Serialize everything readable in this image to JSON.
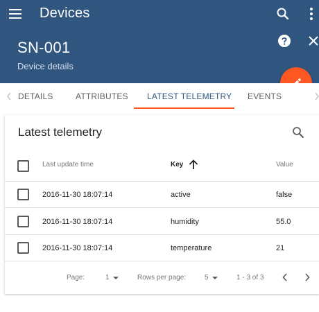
{
  "appbar": {
    "title": "Devices",
    "menu_icon": "menu-icon",
    "search_icon": "search-icon",
    "more_icon": "more-vert-icon"
  },
  "device": {
    "name": "SN-001",
    "subtitle": "Device details",
    "help_icon": "help-icon",
    "close_icon": "close-icon"
  },
  "fab": {
    "icon": "edit-icon",
    "color": "#ff5722"
  },
  "tabs": [
    {
      "label": "DETAILS"
    },
    {
      "label": "ATTRIBUTES"
    },
    {
      "label": "LATEST TELEMETRY",
      "active": true
    },
    {
      "label": "EVENTS"
    }
  ],
  "card": {
    "title": "Latest telemetry",
    "columns": [
      {
        "label": "Last update time"
      },
      {
        "label": "Key",
        "sorted": "ascending"
      },
      {
        "label": "Value"
      }
    ],
    "rows": [
      {
        "time": "2016-11-30 18:07:14",
        "key": "active",
        "value": "false"
      },
      {
        "time": "2016-11-30 18:07:14",
        "key": "humidity",
        "value": "55.0"
      },
      {
        "time": "2016-11-30 18:07:14",
        "key": "temperature",
        "value": "21"
      }
    ],
    "pager": {
      "page_label": "Page:",
      "page": "1",
      "rows_label": "Rows per page:",
      "rows": "5",
      "range": "1 - 3 of 3"
    }
  },
  "colors": {
    "primary": "#305680",
    "accent": "#ff5722"
  }
}
